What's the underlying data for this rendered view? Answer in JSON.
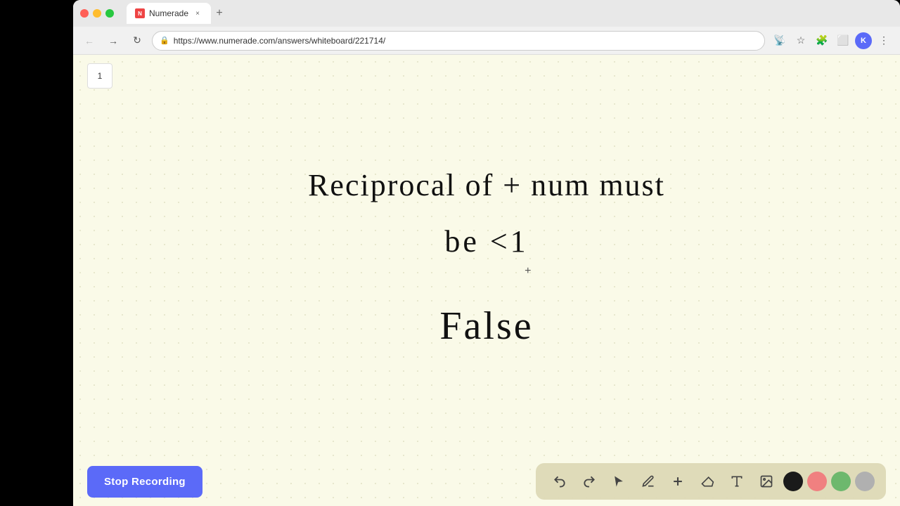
{
  "browser": {
    "tab_title": "Numerade",
    "tab_favicon": "N",
    "url": "https://www.numerade.com/answers/whiteboard/221714/",
    "avatar_initial": "K"
  },
  "page": {
    "page_number": "1"
  },
  "whiteboard": {
    "line1": "Reciprocal  of  + num  must",
    "line2": "be   <1",
    "line3": "False"
  },
  "toolbar": {
    "undo_label": "↩",
    "redo_label": "↪",
    "select_label": "▲",
    "pen_label": "✏",
    "add_label": "+",
    "eraser_label": "◻",
    "text_label": "A",
    "image_label": "🖼"
  },
  "bottom": {
    "stop_recording_label": "Stop Recording"
  },
  "colors": {
    "black": "#1a1a1a",
    "pink": "#f08080",
    "green": "#6db86d",
    "gray": "#b0b0b0",
    "accent": "#5b6af8",
    "bg": "#fafae8"
  }
}
